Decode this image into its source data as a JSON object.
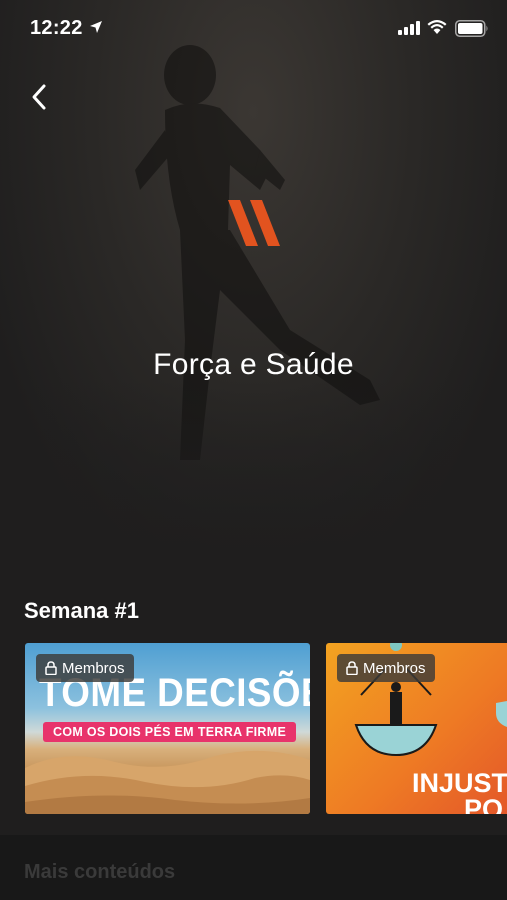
{
  "status_bar": {
    "time": "12:22"
  },
  "header": {
    "title": "Força e Saúde",
    "back_icon": "chevron-left-icon",
    "logo_color": "#e2531f"
  },
  "section": {
    "title": "Semana #1"
  },
  "cards": [
    {
      "badge": "Membros",
      "headline": "TOME DECISÕES",
      "subtitle": "COM OS DOIS PÉS EM",
      "subtitle_highlight": "TERRA FIRME",
      "accent_color": "#e8336b"
    },
    {
      "badge": "Membros",
      "headline": "INJUST",
      "subline": "PO",
      "background_color": "#ee7a24"
    }
  ],
  "bottom": {
    "label": "Mais conteúdos"
  }
}
